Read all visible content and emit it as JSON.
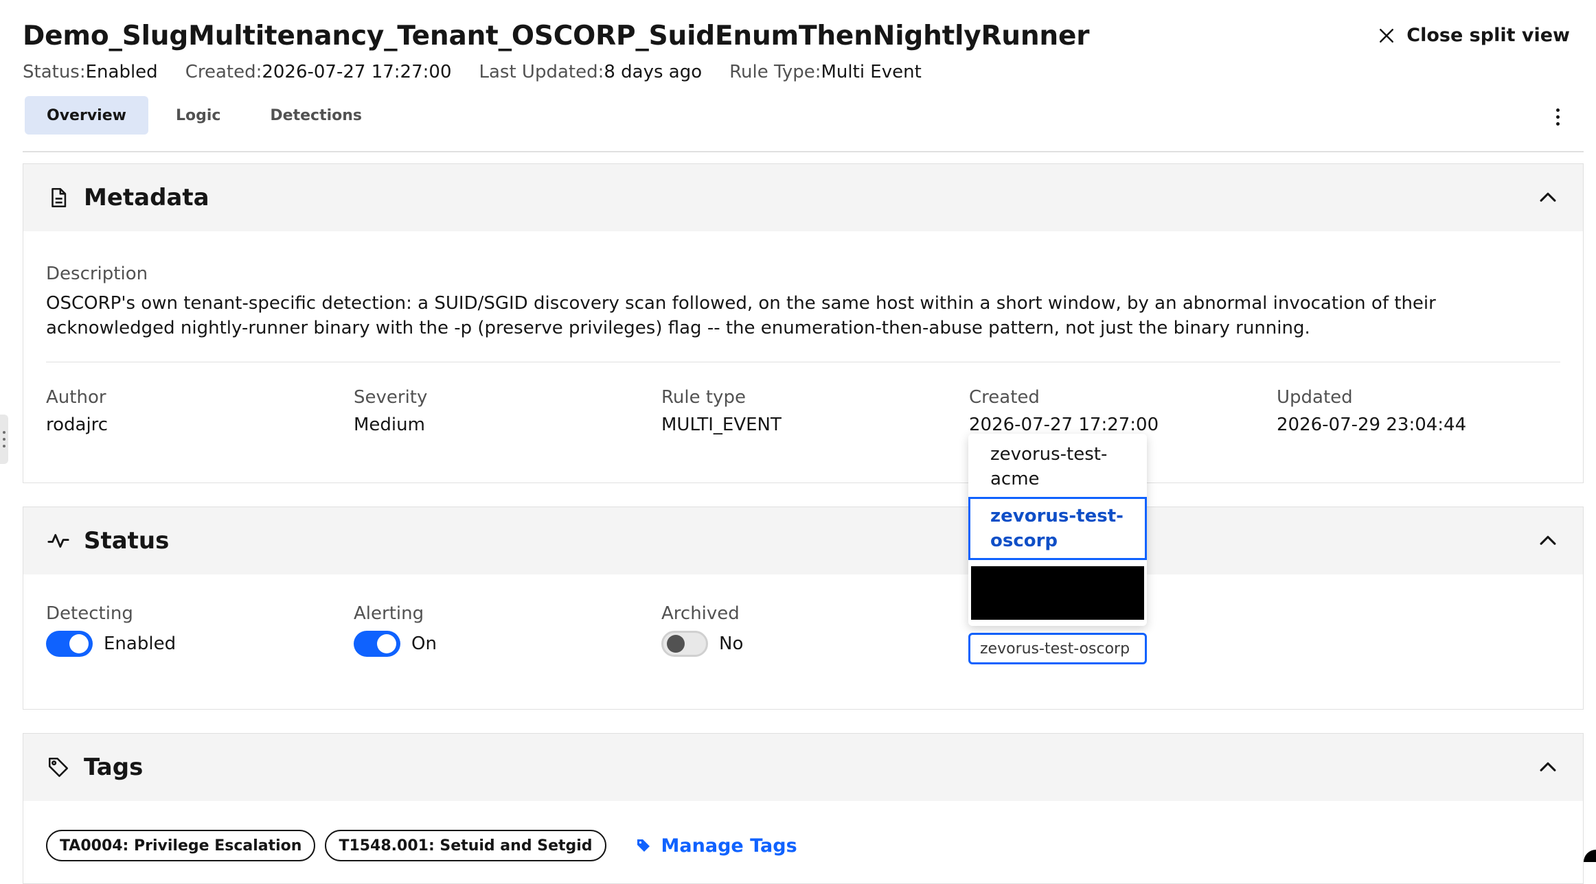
{
  "header": {
    "title": "Demo_SlugMultitenancy_Tenant_OSCORP_SuidEnumThenNightlyRunner",
    "close_label": "Close split view",
    "meta": {
      "status_key": "Status:",
      "status_val": "Enabled",
      "created_key": "Created:",
      "created_val": "2026-07-27 17:27:00",
      "updated_key": "Last Updated:",
      "updated_val": "8 days ago",
      "ruletype_key": "Rule Type:",
      "ruletype_val": "Multi Event"
    }
  },
  "tabs": [
    {
      "label": "Overview",
      "active": true
    },
    {
      "label": "Logic",
      "active": false
    },
    {
      "label": "Detections",
      "active": false
    }
  ],
  "metadata": {
    "title": "Metadata",
    "description_label": "Description",
    "description": "OSCORP's own tenant-specific detection: a SUID/SGID discovery scan followed, on the same host within a short window, by an abnormal invocation of their acknowledged nightly-runner binary with the -p (preserve privileges) flag -- the enumeration-then-abuse pattern, not just the binary running.",
    "fields": {
      "author_label": "Author",
      "author": "rodajrc",
      "severity_label": "Severity",
      "severity": "Medium",
      "ruletype_label": "Rule type",
      "ruletype": "MULTI_EVENT",
      "created_label": "Created",
      "created": "2026-07-27 17:27:00",
      "updated_label": "Updated",
      "updated": "2026-07-29 23:04:44"
    }
  },
  "status": {
    "title": "Status",
    "detecting_label": "Detecting",
    "detecting_value": "Enabled",
    "alerting_label": "Alerting",
    "alerting_value": "On",
    "archived_label": "Archived",
    "archived_value": "No",
    "tenant_selected": "zevorus-test-oscorp",
    "tenant_options": [
      {
        "line1": "zevorus-test-",
        "line2": "acme"
      },
      {
        "line1": "zevorus-test-",
        "line2": "oscorp"
      }
    ]
  },
  "tags": {
    "title": "Tags",
    "items": [
      "TA0004: Privilege Escalation",
      "T1548.001: Setuid and Setgid"
    ],
    "manage_label": "Manage Tags"
  },
  "colors": {
    "accent": "#0f62fe",
    "tab_active_bg": "#dde6f7",
    "card_header_bg": "#f4f4f4"
  }
}
